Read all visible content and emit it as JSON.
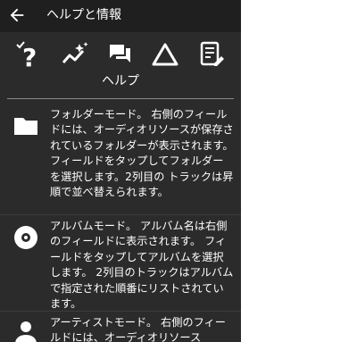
{
  "header": {
    "title": "ヘルプと情報",
    "back_icon": "arrow-left-icon"
  },
  "toolbar": {
    "icons": [
      "help-question-icon",
      "sparkle-trend-icon",
      "chat-icon",
      "triangle-icon",
      "notes-icon"
    ],
    "section_label": "ヘルプ"
  },
  "entries": [
    {
      "icon": "folder-icon",
      "text": "フォルダーモード。 右側のフィールドには、オーディオリソースが保存されているフォルダーが表示されます。フィールドをタップしてフォルダーを選択します。2列目の トラックは昇順で並べ替えられます。"
    },
    {
      "icon": "disc-icon",
      "text": "アルバムモード。 アルバム名は右側のフィールドに表示されます。 フィールドをタップしてアルバムを選択します。 2列目のトラックはアルバムで指定された順番にリストされています。"
    },
    {
      "icon": "person-icon",
      "text": "アーティストモード。 右側のフィールドには、オーディオリソース"
    }
  ],
  "colors": {
    "panel": "#2b2b2b",
    "topbar": "#1f1f1f",
    "text": "#ffffff"
  }
}
